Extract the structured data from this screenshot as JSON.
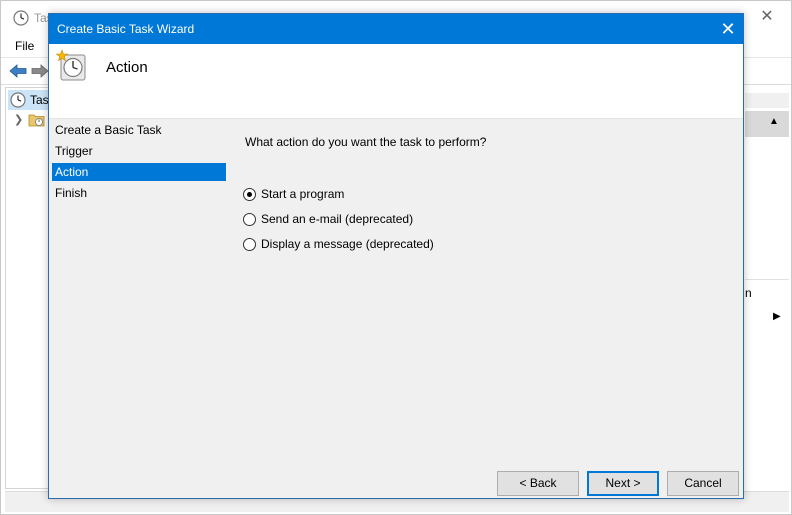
{
  "background_window": {
    "title": "Tas",
    "menu_file": "File",
    "tree_root_label": "Tas",
    "right_pane_text": "n"
  },
  "wizard": {
    "title": "Create Basic Task Wizard",
    "header_title": "Action",
    "steps": [
      {
        "label": "Create a Basic Task"
      },
      {
        "label": "Trigger"
      },
      {
        "label": "Action"
      },
      {
        "label": "Finish"
      }
    ],
    "active_step": "Action",
    "question": "What action do you want the task to perform?",
    "options": [
      {
        "label": "Start a program",
        "selected": true
      },
      {
        "label": "Send an e-mail (deprecated)",
        "selected": false
      },
      {
        "label": "Display a message (deprecated)",
        "selected": false
      }
    ],
    "buttons": {
      "back": "< Back",
      "next": "Next >",
      "cancel": "Cancel"
    }
  },
  "colors": {
    "accent": "#0078d7",
    "dialog_bg": "#f0f0f0",
    "selection_bg": "#cce4f7"
  }
}
